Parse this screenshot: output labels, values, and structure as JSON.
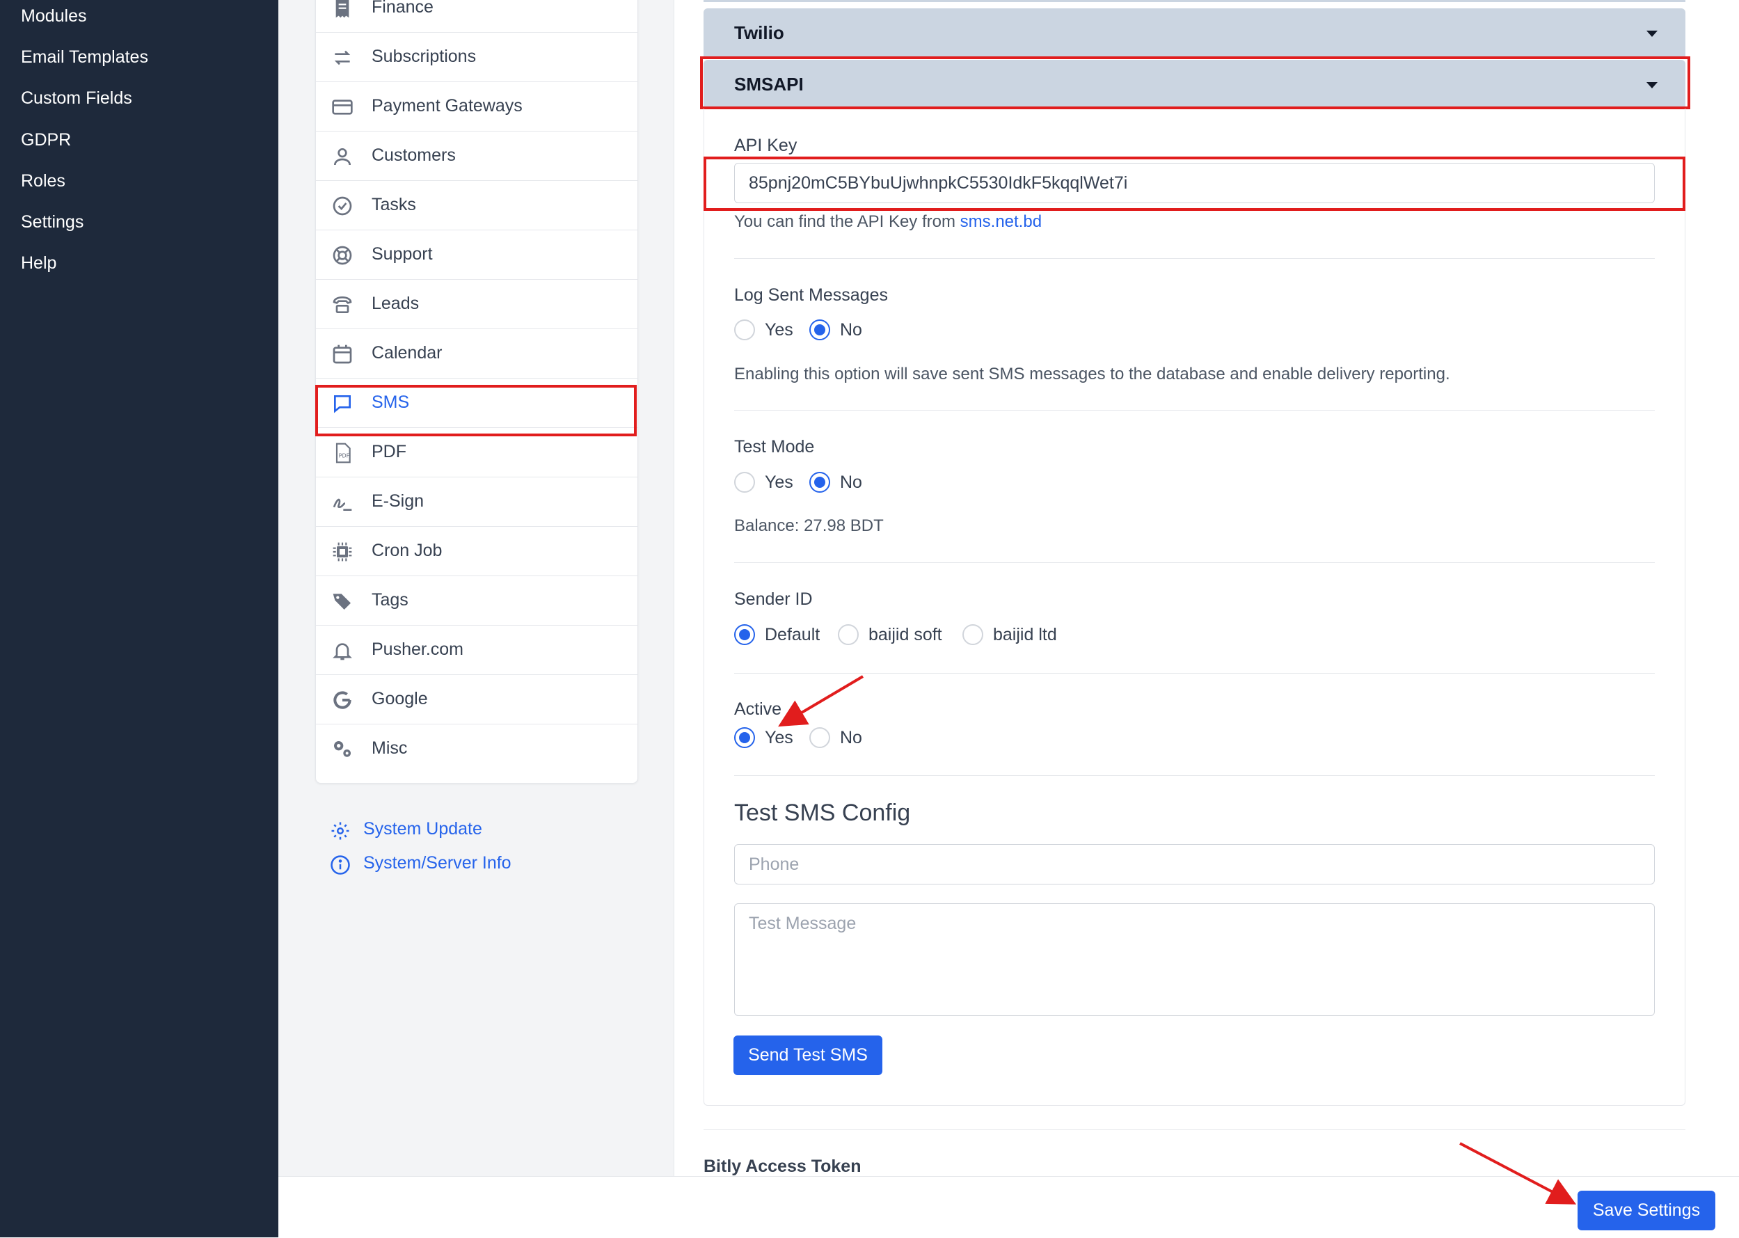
{
  "sidebar": {
    "items": [
      {
        "label": "Modules"
      },
      {
        "label": "Email Templates"
      },
      {
        "label": "Custom Fields"
      },
      {
        "label": "GDPR"
      },
      {
        "label": "Roles"
      },
      {
        "label": "Settings"
      },
      {
        "label": "Help"
      }
    ]
  },
  "settings_menu": {
    "items": [
      {
        "label": "Finance",
        "icon": "receipt-icon"
      },
      {
        "label": "Subscriptions",
        "icon": "refresh-icon"
      },
      {
        "label": "Payment Gateways",
        "icon": "credit-card-icon"
      },
      {
        "label": "Customers",
        "icon": "user-icon"
      },
      {
        "label": "Tasks",
        "icon": "check-circle-icon"
      },
      {
        "label": "Support",
        "icon": "lifebuoy-icon"
      },
      {
        "label": "Leads",
        "icon": "phone-icon"
      },
      {
        "label": "Calendar",
        "icon": "calendar-icon"
      },
      {
        "label": "SMS",
        "icon": "chat-icon",
        "active": true
      },
      {
        "label": "PDF",
        "icon": "pdf-icon"
      },
      {
        "label": "E-Sign",
        "icon": "signature-icon"
      },
      {
        "label": "Cron Job",
        "icon": "chip-icon"
      },
      {
        "label": "Tags",
        "icon": "tags-icon"
      },
      {
        "label": "Pusher.com",
        "icon": "bell-icon"
      },
      {
        "label": "Google",
        "icon": "google-icon"
      },
      {
        "label": "Misc",
        "icon": "cogs-icon"
      }
    ],
    "system_update": "System Update",
    "system_info": "System/Server Info"
  },
  "sms": {
    "twilio_title": "Twilio",
    "smsapi_title": "SMSAPI",
    "api_key_label": "API Key",
    "api_key_value": "85pnj20mC5BYbuUjwhnpkC5530IdkF5kqqlWet7i",
    "api_key_help": "You can find the API Key from ",
    "api_key_link": "sms.net.bd",
    "log_label": "Log Sent Messages",
    "log_yes": "Yes",
    "log_no": "No",
    "log_help": "Enabling this option will save sent SMS messages to the database and enable delivery reporting.",
    "test_mode_label": "Test Mode",
    "test_yes": "Yes",
    "test_no": "No",
    "balance": "Balance: 27.98 BDT",
    "sender_label": "Sender ID",
    "sender_default": "Default",
    "sender_soft": "baijid soft",
    "sender_ltd": "baijid ltd",
    "active_label": "Active",
    "active_yes": "Yes",
    "active_no": "No",
    "test_config_title": "Test SMS Config",
    "phone_placeholder": "Phone",
    "message_placeholder": "Test Message",
    "send_test_button": "Send Test SMS"
  },
  "bitly_label": "Bitly Access Token",
  "save_button": "Save Settings",
  "colors": {
    "sidebar_bg": "#1e293b",
    "accent": "#2563eb",
    "highlight_red": "#e11d1d",
    "accordion_header": "#cbd5e1"
  }
}
